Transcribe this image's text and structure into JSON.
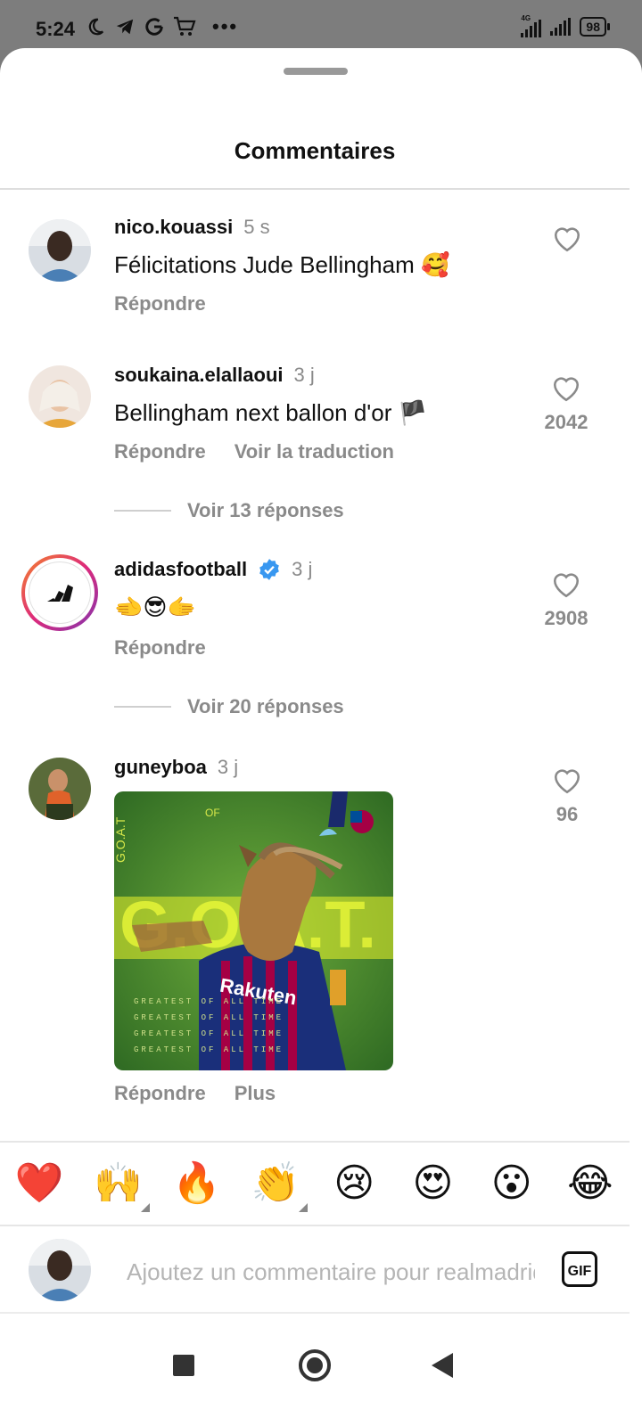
{
  "status_bar": {
    "time": "5:24",
    "network": "4G",
    "battery": "98",
    "icons": [
      "moon-icon",
      "telegram-icon",
      "google-icon",
      "cart-icon",
      "more-icon"
    ]
  },
  "sheet": {
    "title": "Commentaires"
  },
  "comments": [
    {
      "username": "nico.kouassi",
      "time": "5 s",
      "text": "Félicitations Jude Bellingham 🥰",
      "reply_label": "Répondre",
      "likes": ""
    },
    {
      "username": "soukaina.elallaoui",
      "time": "3 j",
      "text": "Bellingham next ballon d'or 🏴",
      "reply_label": "Répondre",
      "translate_label": "Voir la traduction",
      "likes": "2042",
      "view_replies": "Voir 13 réponses"
    },
    {
      "username": "adidasfootball",
      "verified": true,
      "time": "3 j",
      "text": "🫲😎🫱",
      "reply_label": "Répondre",
      "likes": "2908",
      "view_replies": "Voir 20 réponses"
    },
    {
      "username": "guneyboa",
      "time": "3 j",
      "reply_label": "Répondre",
      "more_label": "Plus",
      "likes": "96",
      "gif": {
        "side_text": "G.O.A.T",
        "shirt_text": "Rakuten",
        "bg_text": "G.O.A.T.",
        "rows": [
          "GREATEST OF ALL TIME",
          "GREATEST OF ALL TIME",
          "GREATEST OF ALL TIME",
          "GREATEST OF ALL TIME"
        ],
        "of_text": "OF"
      }
    }
  ],
  "emoji_bar": [
    "❤️",
    "🙌",
    "🔥",
    "👏",
    "😢",
    "😍",
    "😮",
    "😂"
  ],
  "input": {
    "placeholder": "Ajoutez un commentaire pour realmadrid...",
    "gif_label": "GIF"
  },
  "colors": {
    "accent_verified": "#3897f0",
    "story_ring_start": "#f58529",
    "story_ring_end": "#dd2a7b",
    "heart_red": "#e0262f"
  }
}
